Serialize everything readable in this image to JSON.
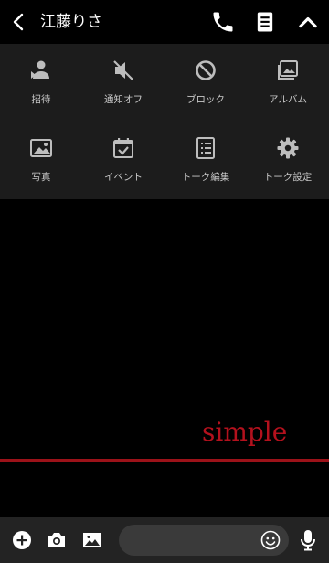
{
  "header": {
    "back_icon": "chevron-left-icon",
    "title": "江藤りさ",
    "phone_icon": "phone-icon",
    "notes_icon": "notes-icon",
    "collapse_icon": "chevron-up-icon"
  },
  "menu": {
    "items": [
      {
        "label": "招待",
        "icon": "invite-person-icon"
      },
      {
        "label": "通知オフ",
        "icon": "speaker-muted-icon"
      },
      {
        "label": "ブロック",
        "icon": "block-icon"
      },
      {
        "label": "アルバム",
        "icon": "album-icon"
      },
      {
        "label": "写真",
        "icon": "photo-icon"
      },
      {
        "label": "イベント",
        "icon": "calendar-check-icon"
      },
      {
        "label": "トーク編集",
        "icon": "edit-list-icon"
      },
      {
        "label": "トーク設定",
        "icon": "gear-icon"
      }
    ]
  },
  "chat": {
    "background_text": "simple",
    "accent_color": "#b3111d"
  },
  "footer": {
    "icons": [
      "plus-circle-icon",
      "camera-icon",
      "image-icon",
      "emoji-icon",
      "microphone-icon"
    ]
  }
}
